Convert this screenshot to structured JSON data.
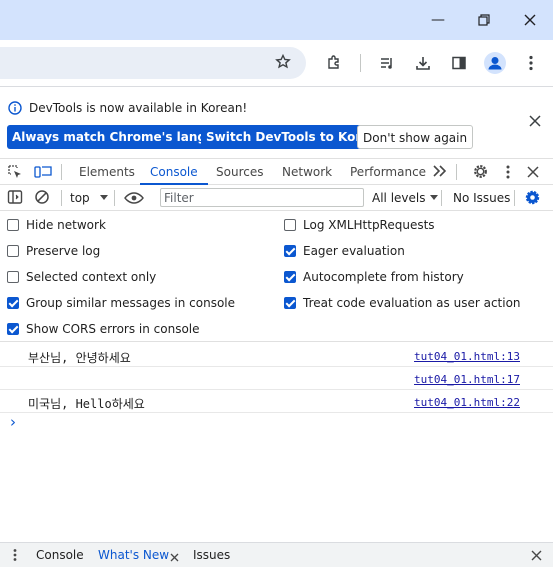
{
  "infobar": {
    "message": "DevTools is now available in Korean!",
    "btn_match": "Always match Chrome's language",
    "btn_switch": "Switch DevTools to Korean",
    "btn_dont": "Don't show again"
  },
  "devtools_tabs": [
    "Elements",
    "Console",
    "Sources",
    "Network",
    "Performance"
  ],
  "active_tab": "Console",
  "filterbar": {
    "context": "top",
    "filter_placeholder": "Filter",
    "levels": "All levels",
    "issues": "No Issues"
  },
  "settings": {
    "left": [
      {
        "label": "Hide network",
        "checked": false
      },
      {
        "label": "Preserve log",
        "checked": false
      },
      {
        "label": "Selected context only",
        "checked": false
      },
      {
        "label": "Group similar messages in console",
        "checked": true
      },
      {
        "label": "Show CORS errors in console",
        "checked": true
      }
    ],
    "right": [
      {
        "label": "Log XMLHttpRequests",
        "checked": false
      },
      {
        "label": "Eager evaluation",
        "checked": true
      },
      {
        "label": "Autocomplete from history",
        "checked": true
      },
      {
        "label": "Treat code evaluation as user action",
        "checked": true
      }
    ]
  },
  "console_messages": [
    {
      "text": "부산님, 안녕하세요",
      "source": "tut04_01.html:13"
    },
    {
      "text": "",
      "source": "tut04_01.html:17"
    },
    {
      "text": "미국님, Hello하세요",
      "source": "tut04_01.html:22"
    }
  ],
  "prompt_symbol": "›",
  "drawer": {
    "tabs": [
      "Console",
      "What's New",
      "Issues"
    ],
    "active": "What's New"
  },
  "colors": {
    "accent": "#0b57d0",
    "titlebar": "#d3e3fd",
    "link": "#1a1aa6"
  }
}
